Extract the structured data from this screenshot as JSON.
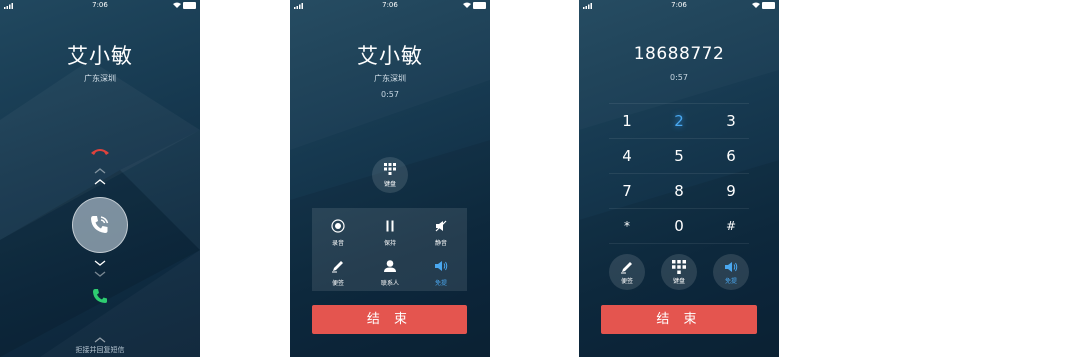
{
  "status_bar": {
    "time": "7:06"
  },
  "incoming": {
    "caller_name": "艾小敏",
    "location": "广东深圳",
    "reply_hint": "拒接并回复短信"
  },
  "active_call": {
    "caller_name": "艾小敏",
    "location": "广东深圳",
    "duration": "0:57",
    "keypad_label": "键盘",
    "controls": [
      {
        "label": "录音",
        "icon": "record-icon"
      },
      {
        "label": "保持",
        "icon": "pause-icon"
      },
      {
        "label": "静音",
        "icon": "mute-icon"
      },
      {
        "label": "便签",
        "icon": "pencil-icon"
      },
      {
        "label": "联系人",
        "icon": "contact-icon"
      },
      {
        "label": "免提",
        "icon": "speaker-icon",
        "active": true
      }
    ],
    "end_label": "结 束"
  },
  "dialpad_call": {
    "number": "18688772",
    "duration": "0:57",
    "keys": [
      [
        "1",
        "2",
        "3"
      ],
      [
        "4",
        "5",
        "6"
      ],
      [
        "7",
        "8",
        "9"
      ],
      [
        "*",
        "0",
        "#"
      ]
    ],
    "highlighted_key": "2",
    "buttons": [
      {
        "label": "便签",
        "icon": "pencil-icon"
      },
      {
        "label": "键盘",
        "icon": "keypad-icon"
      },
      {
        "label": "免提",
        "icon": "speaker-icon",
        "active": true
      }
    ],
    "end_label": "结 束"
  },
  "colors": {
    "accent": "#4aa8f0",
    "end_call": "#e4554f",
    "answer": "#2ecc71",
    "decline": "#e0423c",
    "background": "#173a51"
  }
}
